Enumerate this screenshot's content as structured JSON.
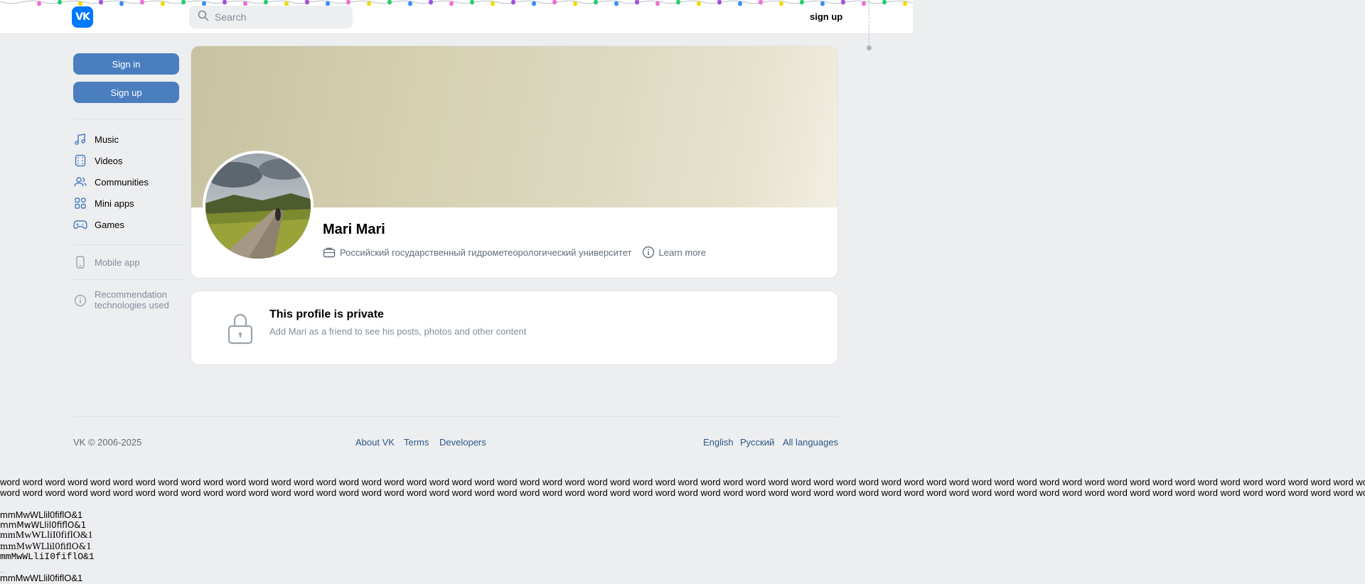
{
  "header": {
    "logo_text": "VK",
    "search_placeholder": "Search",
    "signup_label": "sign up"
  },
  "sidebar": {
    "signin_button": "Sign in",
    "signup_button": "Sign up",
    "items": [
      {
        "label": "Music",
        "icon": "music-note-icon"
      },
      {
        "label": "Videos",
        "icon": "video-icon"
      },
      {
        "label": "Communities",
        "icon": "users-icon"
      },
      {
        "label": "Mini apps",
        "icon": "grid-icon"
      },
      {
        "label": "Games",
        "icon": "gamepad-icon"
      }
    ],
    "mobile_app": "Mobile app",
    "recommendation": "Recommendation technologies used"
  },
  "profile": {
    "name": "Mari Mari",
    "university": "Российский государственный гидрометеорологический университет",
    "learn_more": "Learn more"
  },
  "private": {
    "title": "This profile is private",
    "subtitle": "Add Mari as a friend to see his posts, photos and other content"
  },
  "footer": {
    "copyright": "VK © 2006-2025",
    "links": [
      "About VK",
      "Terms",
      "Developers"
    ],
    "languages": [
      "English",
      "Русский",
      "All languages"
    ]
  },
  "test_text": {
    "words_line": "word word word word word word word word word word word word word word word word word word word word word word word word word word word word word word word word word word word word word word word word word word word word word word word word word word word word word word word word word word word word word word",
    "font_samples": [
      "mmMwWLlil0fiflO&1",
      "mmMwWLlil0fiflO&1",
      "mmMwWLliI0fiflO&1",
      "mmMwWLlil0fiflO&1",
      "mmMwWLliI0fiflO&1",
      "mmMwWLlil0fiflO&1"
    ]
  },
  "colors": {
    "accent": "#4a7ebf",
    "logo": "#0077ff",
    "background": "#edeef0",
    "link": "#2a5885"
  }
}
